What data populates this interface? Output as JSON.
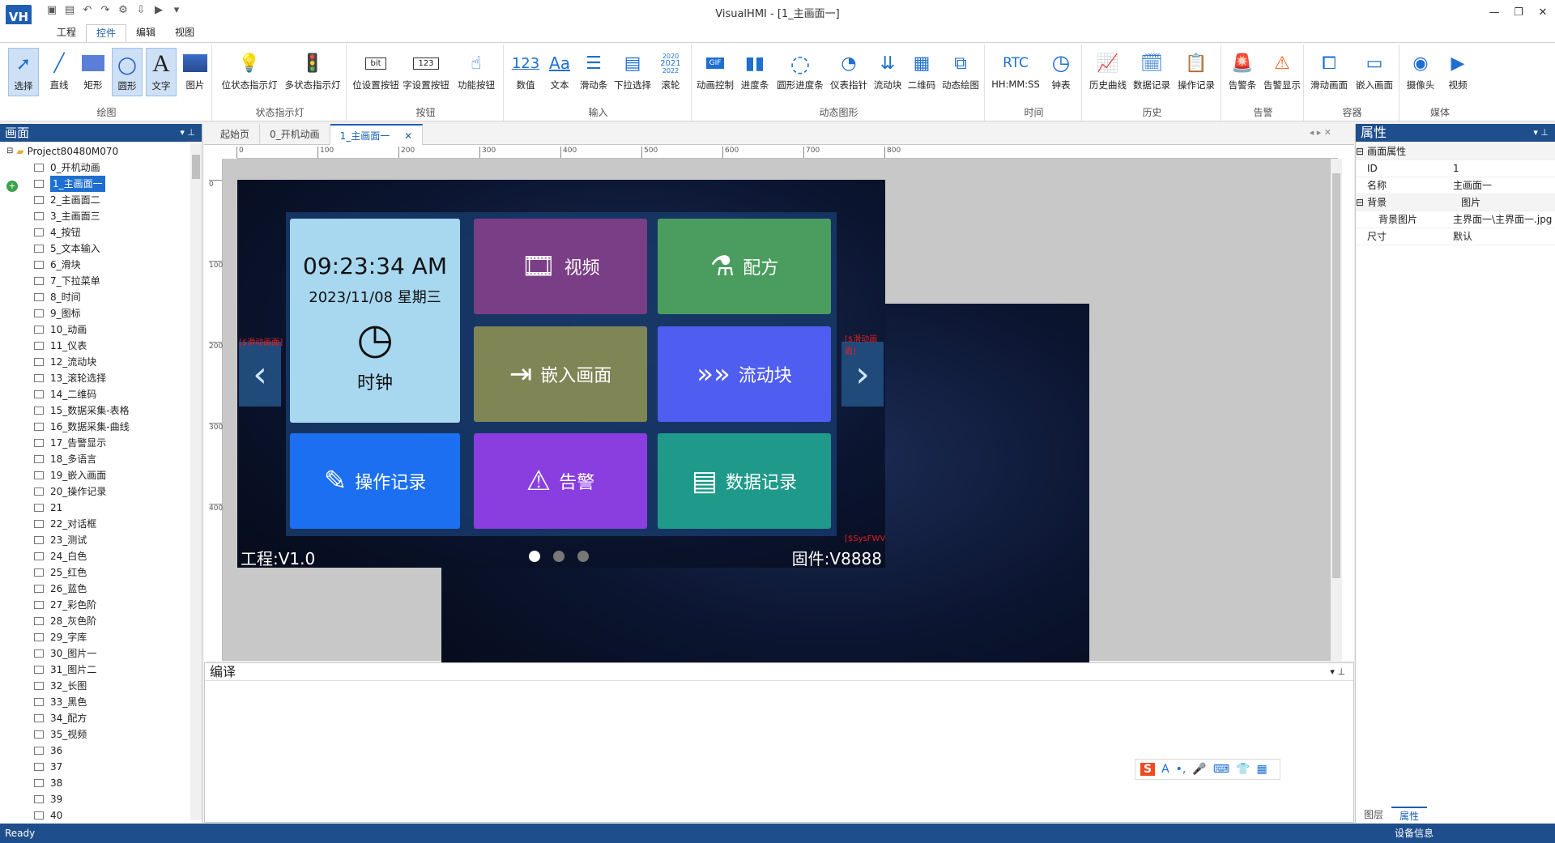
{
  "window": {
    "title": "VisualHMI - [1_主画面一]"
  },
  "menu": {
    "items": [
      "工程",
      "控件",
      "编辑",
      "视图"
    ],
    "active": "控件"
  },
  "ribbon": {
    "groups": [
      {
        "label": "绘图",
        "buttons": [
          "选择",
          "直线",
          "矩形",
          "圆形",
          "文字",
          "图片"
        ]
      },
      {
        "label": "状态指示灯",
        "buttons": [
          "位状态指示灯",
          "多状态指示灯"
        ]
      },
      {
        "label": "按钮",
        "buttons": [
          "位设置按钮",
          "字设置按钮",
          "功能按钮"
        ]
      },
      {
        "label": "输入",
        "buttons": [
          "数值",
          "文本",
          "滑动条",
          "下拉选择",
          "滚轮"
        ]
      },
      {
        "label": "动态图形",
        "buttons": [
          "动画控制",
          "进度条",
          "圆形进度条",
          "仪表指针",
          "流动块",
          "二维码",
          "动态绘图"
        ]
      },
      {
        "label": "时间",
        "buttons": [
          "HH:MM:SS",
          "钟表"
        ]
      },
      {
        "label": "历史",
        "buttons": [
          "历史曲线",
          "数据记录",
          "操作记录"
        ]
      },
      {
        "label": "告警",
        "buttons": [
          "告警条",
          "告警显示"
        ]
      },
      {
        "label": "容器",
        "buttons": [
          "滑动画面",
          "嵌入画面"
        ]
      },
      {
        "label": "媒体",
        "buttons": [
          "摄像头",
          "视频"
        ]
      }
    ],
    "icon_text": {
      "num": "123",
      "text": "Aa",
      "rtc": "RTC",
      "gif": "GIF",
      "bit": "bit",
      "word": "123",
      "years": [
        "2020",
        "2021",
        "2022"
      ]
    }
  },
  "left_panel": {
    "title": "画面",
    "project": "Project80480M070",
    "screens": [
      "0_开机动画",
      "1_主画面一",
      "2_主画面二",
      "3_主画面三",
      "4_按钮",
      "5_文本输入",
      "6_滑块",
      "7_下拉菜单",
      "8_时间",
      "9_图标",
      "10_动画",
      "11_仪表",
      "12_流动块",
      "13_滚轮选择",
      "14_二维码",
      "15_数据采集-表格",
      "16_数据采集-曲线",
      "17_告警显示",
      "18_多语言",
      "19_嵌入画面",
      "20_操作记录",
      "21",
      "22_对话框",
      "23_测试",
      "24_白色",
      "25_红色",
      "26_蓝色",
      "27_彩色阶",
      "28_灰色阶",
      "29_字库",
      "30_图片一",
      "31_图片二",
      "32_长图",
      "33_黑色",
      "34_配方",
      "35_视频",
      "36",
      "37",
      "38",
      "39",
      "40"
    ],
    "selected_index": 1
  },
  "tabs": [
    "起始页",
    "0_开机动画",
    "1_主画面一"
  ],
  "active_tab": "1_主画面一",
  "ruler": {
    "h": [
      "0",
      "100",
      "200",
      "300",
      "400",
      "500",
      "600",
      "700",
      "800"
    ],
    "v": [
      "0",
      "100",
      "200",
      "300",
      "400"
    ]
  },
  "hmi": {
    "clock": {
      "time": "09:23:34 AM",
      "date": "2023/11/08 星期三",
      "label": "时钟"
    },
    "cards": [
      "视频",
      "配方",
      "嵌入画面",
      "流动块",
      "操作记录",
      "告警",
      "数据记录"
    ],
    "project_version": "工程:V1.0",
    "firmware": "固件:V8888",
    "slide_tag": "[$滑动画面]",
    "fw_tag": "[$SysFWVer]",
    "colors": {
      "clock": "#a8d8f0",
      "video": "#7a3e86",
      "recipe": "#4a9d5f",
      "embed": "#7f8555",
      "flow": "#4f5ef0",
      "oplog": "#1b6ff0",
      "alarm": "#8a3ee0",
      "datalog": "#1f9a8a"
    }
  },
  "compile_panel": {
    "title": "编译"
  },
  "properties": {
    "title": "属性",
    "rows": [
      {
        "type": "cat",
        "key": "画面属性",
        "value": ""
      },
      {
        "type": "row",
        "key": "ID",
        "value": "1"
      },
      {
        "type": "row",
        "key": "名称",
        "value": "主画面一"
      },
      {
        "type": "cat",
        "key": "背景",
        "value": "图片"
      },
      {
        "type": "sub",
        "key": "背景图片",
        "value": "主界面一\\主界面一.jpg"
      },
      {
        "type": "row",
        "key": "尺寸",
        "value": "默认"
      }
    ],
    "bottom_tabs": [
      "图层",
      "属性"
    ],
    "active_bottom_tab": "属性"
  },
  "status": {
    "left": "Ready",
    "right": "设备信息"
  }
}
